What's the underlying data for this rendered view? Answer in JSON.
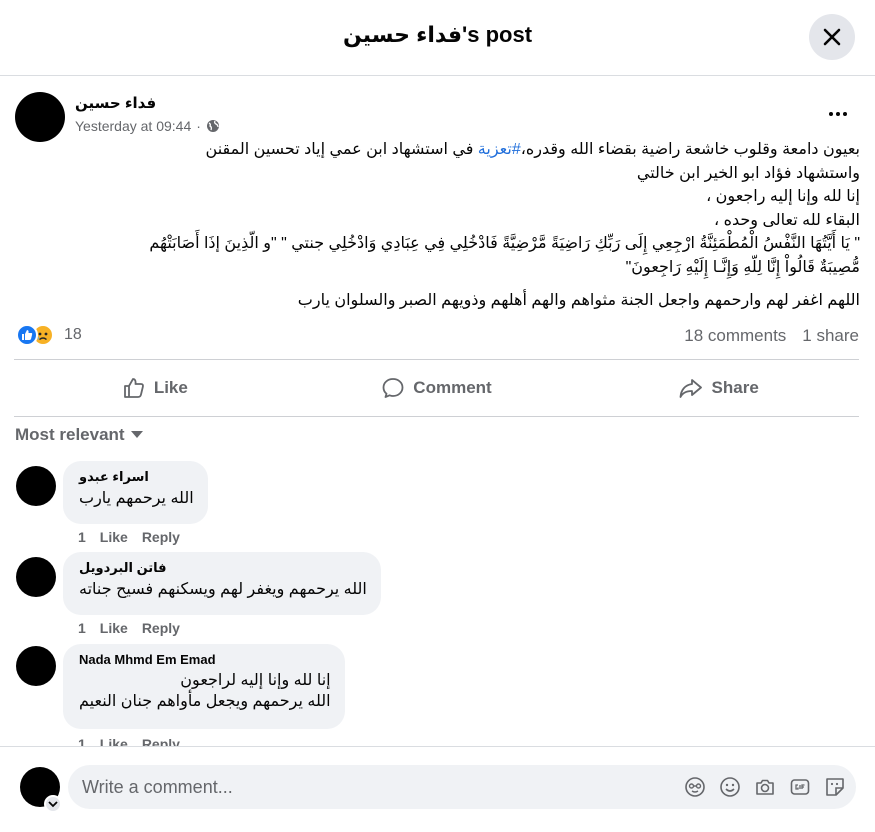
{
  "header": {
    "title": "فداء حسين's post"
  },
  "post": {
    "author": "فداء حسين",
    "time": "Yesterday at 09:44",
    "dot": "·",
    "line1_a": "بعيون دامعة وقلوب خاشعة راضية بقضاء الله وقدره،",
    "hashtag": "#تعزية",
    "line1_b": "في استشهاد ابن عمي إياد تحسين المقنن",
    "line2": "واستشهاد فؤاد ابو الخير ابن خالتي",
    "line3": "إنا لله وإنا إليه راجعون ،",
    "line4": "البقاء لله تعالى وحده ،",
    "line5": "\" يَا أَيَّتُهَا النَّفْسُ الْمُطْمَئِنَّةُ ارْجِعِي إِلَى رَبِّكِ رَاضِيَةً مَّرْضِيَّةً فَادْخُلِي فِي عِبَادِي وَادْخُلِي جنتي \" \"و الّذِينَ إذَا أَصَابَتْهُم",
    "line6": "مُّصِيبَةٌ قَالُواْ إِنَّا لِلّهِ وَإِنَّـا إِلَيْهِ رَاجِعونَ\"",
    "line7": "اللهم اغفر لهم وارحمهم واجعل الجنة مثواهم والهم أهلهم وذويهم الصبر والسلوان يارب",
    "reaction_count": "18",
    "comments_count": "18 comments",
    "shares_count": "1 share"
  },
  "actions": {
    "like": "Like",
    "comment": "Comment",
    "share": "Share"
  },
  "sort_label": "Most relevant",
  "comments": [
    {
      "name": "اسراء عبدو",
      "lines": [
        "الله يرحمهم يارب"
      ],
      "time": "1",
      "like": "Like",
      "reply": "Reply"
    },
    {
      "name": "فاتن البردويل",
      "lines": [
        "الله يرحمهم ويغفر لهم ويسكنهم فسيح جناته"
      ],
      "time": "1",
      "like": "Like",
      "reply": "Reply"
    },
    {
      "name": "Nada Mhmd Em Emad",
      "lines": [
        "إنا لله وإنا إليه لراجعون",
        "الله يرحمهم ويجعل مأواهم جنان النعيم"
      ],
      "time": "1",
      "like": "Like",
      "reply": "Reply"
    }
  ],
  "composer": {
    "placeholder": "Write a comment..."
  },
  "colors": {
    "accent": "#1877f2",
    "hashtag": "#216fdb",
    "muted": "#65676b",
    "bubble": "#f0f2f5"
  },
  "icons": [
    "close-icon",
    "globe-icon",
    "more-icon",
    "like-reaction-icon",
    "sad-reaction-icon",
    "thumbs-up-icon",
    "comment-icon",
    "share-icon",
    "caret-down-icon",
    "avatar-icon",
    "emoji-icon",
    "camera-icon",
    "gif-icon",
    "sticker-icon"
  ]
}
